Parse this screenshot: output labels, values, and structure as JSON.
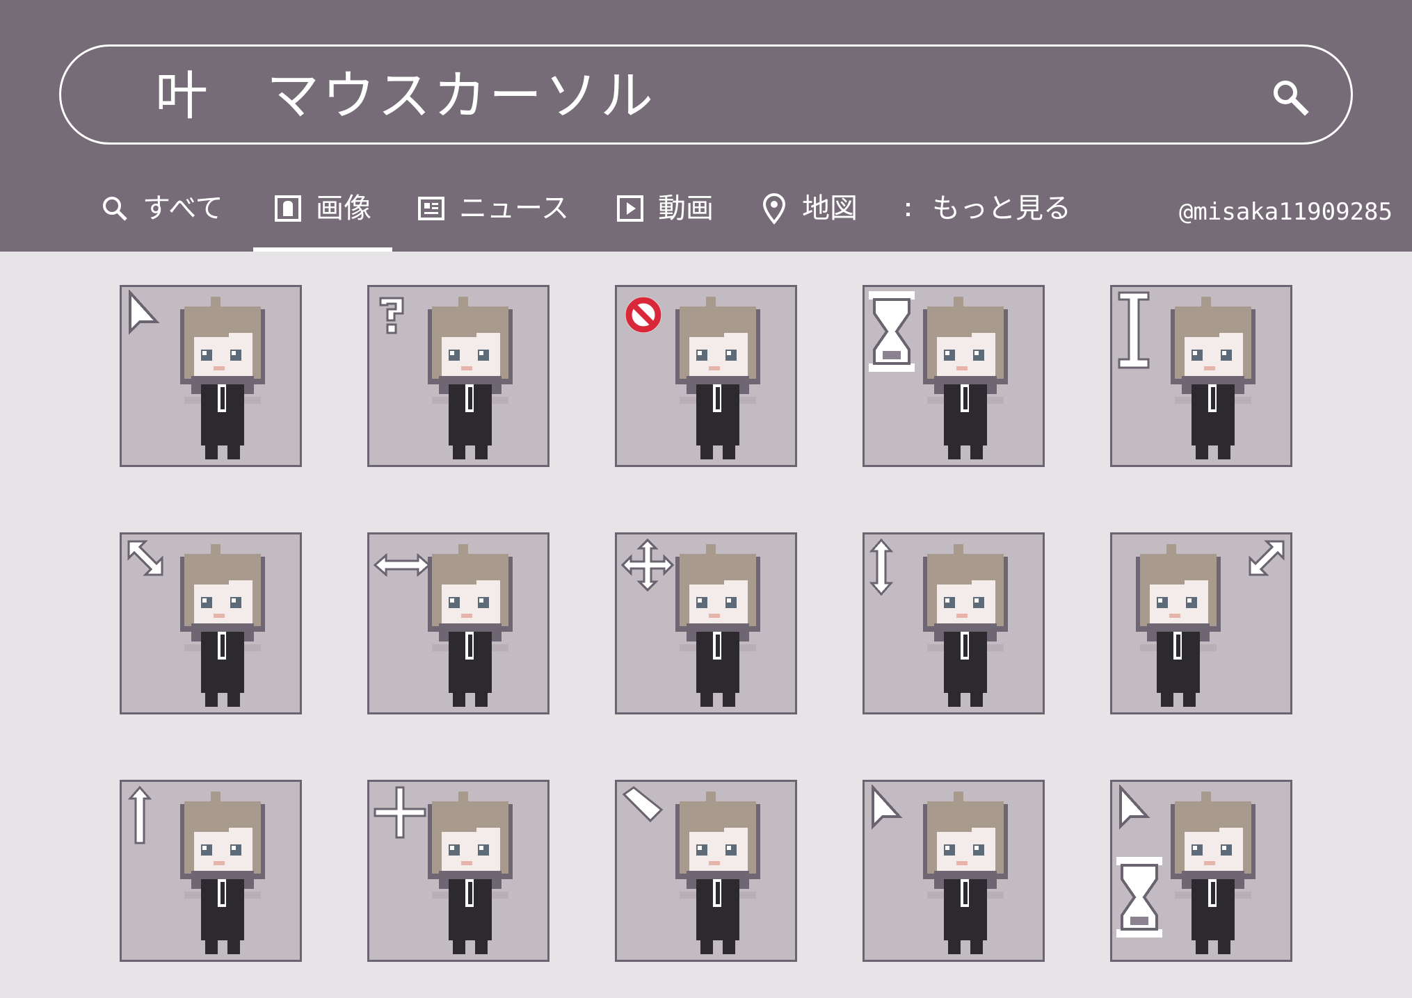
{
  "search": {
    "query": "叶　マウスカーソル"
  },
  "tabs": [
    {
      "label": "すべて",
      "icon": "search-icon",
      "active": false
    },
    {
      "label": "画像",
      "icon": "image-icon",
      "active": true
    },
    {
      "label": "ニュース",
      "icon": "news-icon",
      "active": false
    },
    {
      "label": "動画",
      "icon": "video-icon",
      "active": false
    },
    {
      "label": "地図",
      "icon": "map-pin-icon",
      "active": false
    },
    {
      "label": "もっと見る",
      "icon": "more-vert-icon",
      "active": false
    }
  ],
  "credit": "@misaka11909285",
  "colors": {
    "header": "#766c77",
    "background": "#e6e4e7",
    "tile": "#c2bcc2",
    "tile_border": "#6a6470",
    "hair": "#a89a8c",
    "suit": "#2c2a2e",
    "unavailable_red": "#d8283a"
  },
  "cursor_tiles": [
    {
      "icon": "arrow-pointer-icon"
    },
    {
      "icon": "help-question-icon"
    },
    {
      "icon": "unavailable-icon"
    },
    {
      "icon": "busy-hourglass-icon"
    },
    {
      "icon": "text-ibeam-icon"
    },
    {
      "icon": "resize-diagonal-nwse-icon"
    },
    {
      "icon": "resize-horizontal-icon"
    },
    {
      "icon": "move-icon"
    },
    {
      "icon": "resize-vertical-icon"
    },
    {
      "icon": "resize-diagonal-nesw-icon"
    },
    {
      "icon": "alternate-up-arrow-icon"
    },
    {
      "icon": "precision-crosshair-icon"
    },
    {
      "icon": "handwriting-pen-icon"
    },
    {
      "icon": "link-select-icon"
    },
    {
      "icon": "working-in-background-icon"
    }
  ]
}
